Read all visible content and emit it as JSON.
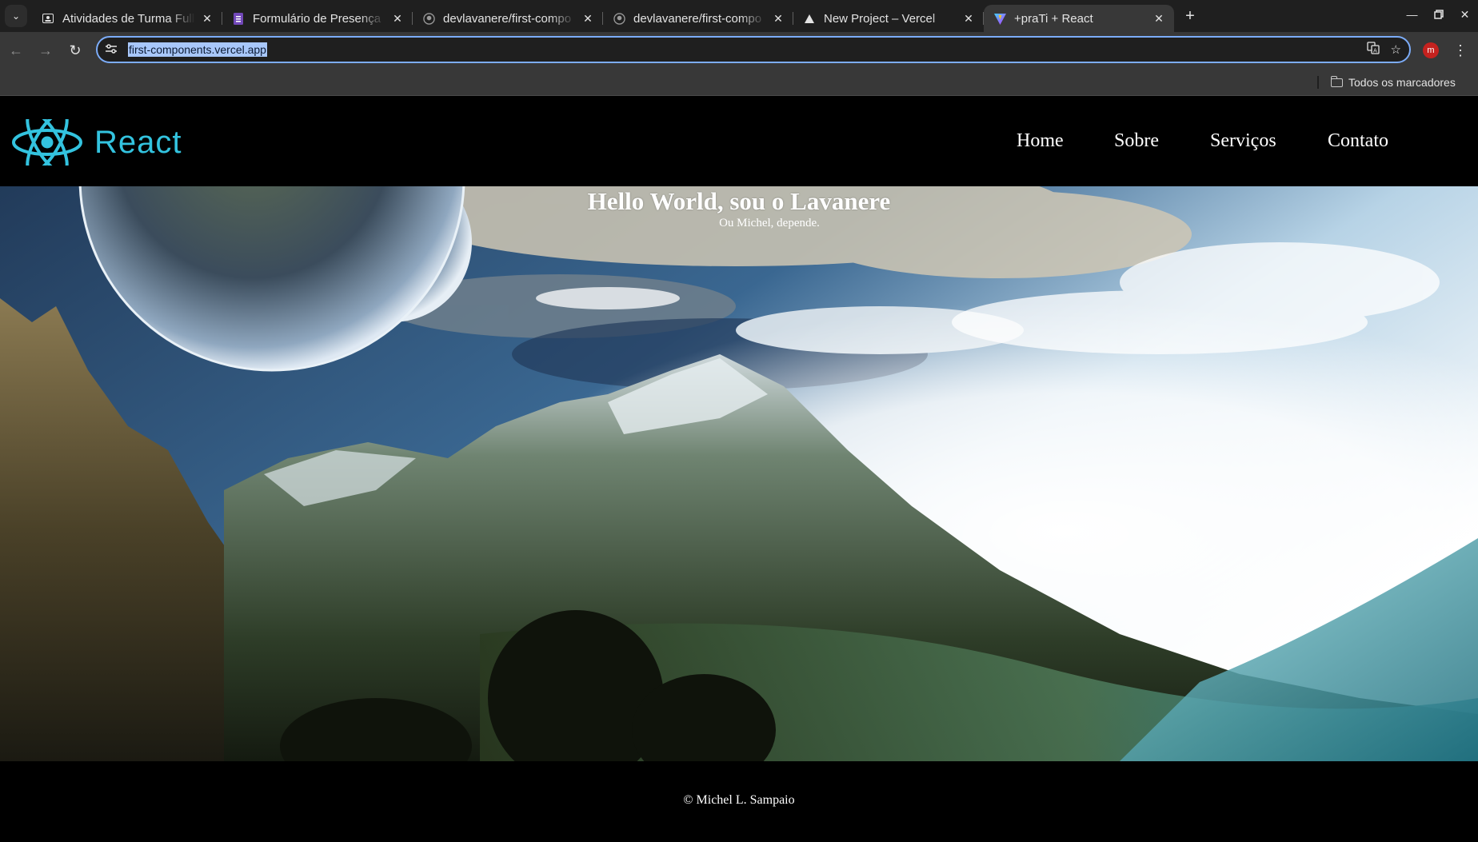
{
  "browser": {
    "tabs": [
      {
        "title": "Atividades de Turma Full",
        "icon": "classroom-icon",
        "active": false
      },
      {
        "title": "Formulário de Presença",
        "icon": "forms-icon",
        "active": false
      },
      {
        "title": "devlavanere/first-compo",
        "icon": "github-icon",
        "active": false
      },
      {
        "title": "devlavanere/first-compo",
        "icon": "github-icon",
        "active": false
      },
      {
        "title": "New Project – Vercel",
        "icon": "vercel-icon",
        "active": false
      },
      {
        "title": "+praTi + React",
        "icon": "vite-icon",
        "active": true
      }
    ],
    "url": "first-components.vercel.app",
    "profile_initial": "m",
    "bookmarks_all_label": "Todos os marcadores",
    "colors": {
      "accent": "#7cacf8",
      "profile": "#c5221f"
    }
  },
  "site": {
    "logo_text": "React",
    "logo_color": "#33c3df",
    "nav": [
      "Home",
      "Sobre",
      "Serviços",
      "Contato"
    ],
    "hero_title": "Hello World, sou o Lavanere",
    "hero_subtitle": "Ou Michel, depende.",
    "footer_text": "© Michel L. Sampaio"
  }
}
